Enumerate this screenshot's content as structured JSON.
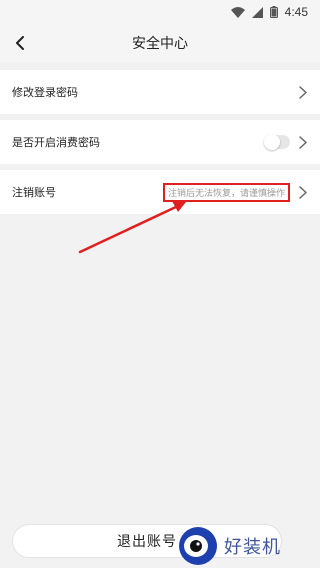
{
  "status_bar": {
    "time": "4:45"
  },
  "header": {
    "title": "安全中心"
  },
  "settings": [
    {
      "label": "修改登录密码",
      "type": "link"
    },
    {
      "label": "是否开启消费密码",
      "type": "toggle",
      "toggle_on": false
    },
    {
      "label": "注销账号",
      "type": "link",
      "hint": "注销后无法恢复，请谨慎操作"
    }
  ],
  "footer": {
    "logout_label": "退出账号"
  },
  "watermark": {
    "text": "好装机"
  },
  "colors": {
    "accent_red": "#e02020",
    "background": "#f2f2f2",
    "brand_blue": "#1e3a8a"
  }
}
